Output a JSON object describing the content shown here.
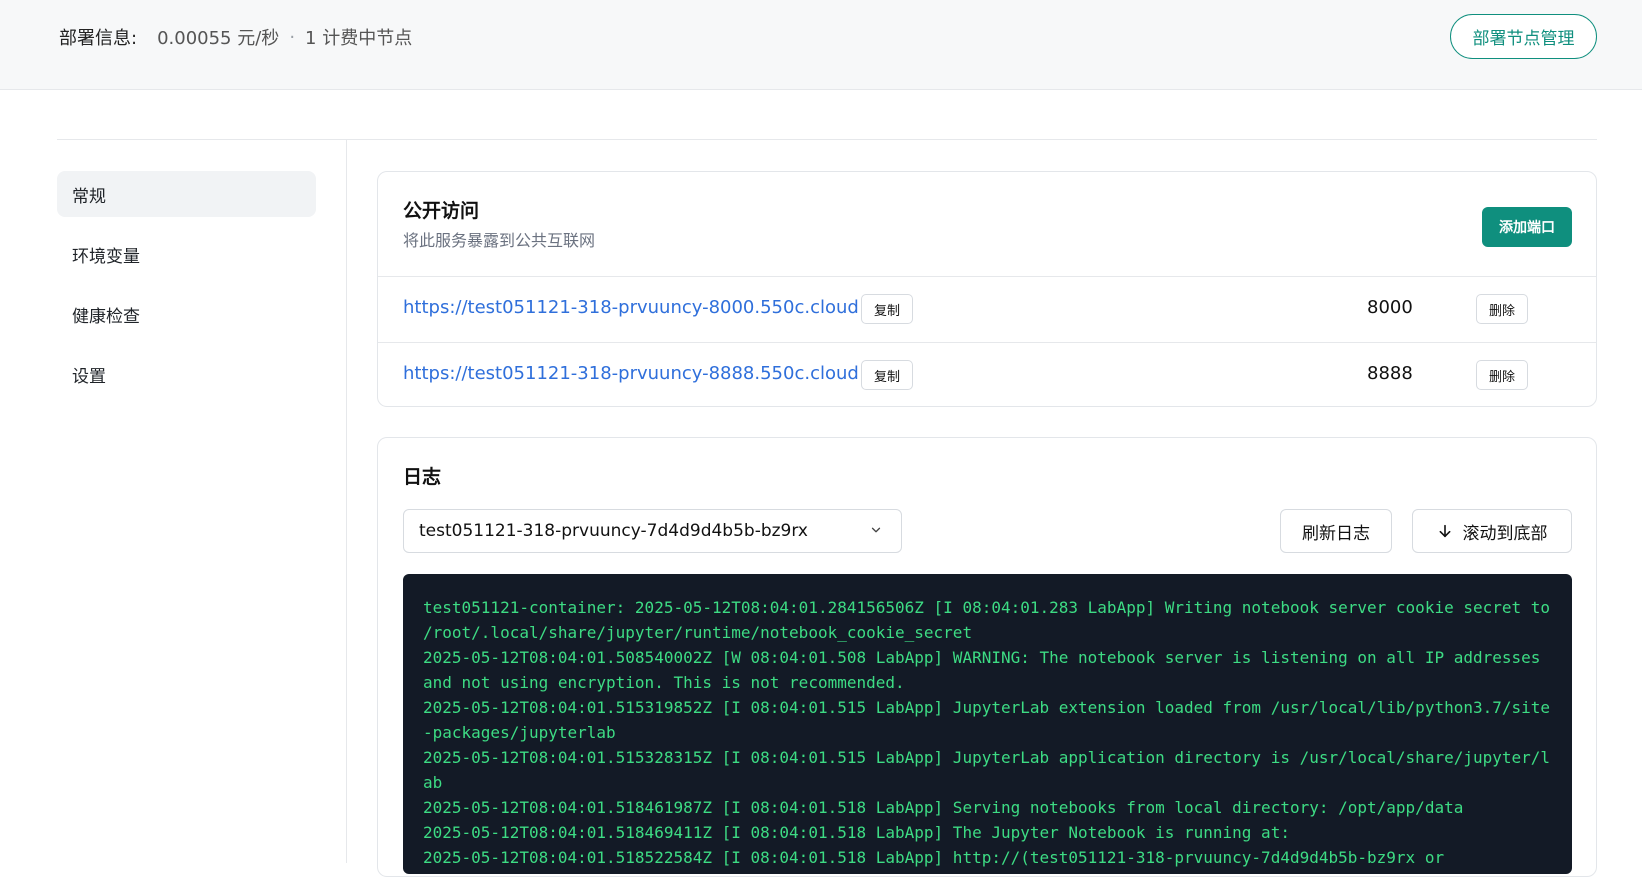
{
  "header": {
    "deploy_label": "部署信息:",
    "price": "0.00055 元/秒",
    "separator": "·",
    "nodes": "1 计费中节点",
    "node_mgmt_button": "部署节点管理"
  },
  "sidebar": {
    "items": [
      {
        "label": "常规",
        "active": true
      },
      {
        "label": "环境变量",
        "active": false
      },
      {
        "label": "健康检查",
        "active": false
      },
      {
        "label": "设置",
        "active": false
      }
    ]
  },
  "public_access": {
    "title": "公开访问",
    "subtitle": "将此服务暴露到公共互联网",
    "add_port_button": "添加端口",
    "ports": [
      {
        "url": "https://test051121-318-prvuuncy-8000.550c.cloud",
        "copy_label": "复制",
        "port": "8000",
        "delete_label": "删除"
      },
      {
        "url": "https://test051121-318-prvuuncy-8888.550c.cloud",
        "copy_label": "复制",
        "port": "8888",
        "delete_label": "删除"
      }
    ]
  },
  "logs": {
    "title": "日志",
    "pod_selected": "test051121-318-prvuuncy-7d4d9d4b5b-bz9rx",
    "refresh_button": "刷新日志",
    "scroll_button": "滚动到底部",
    "lines": [
      "test051121-container: 2025-05-12T08:04:01.284156506Z [I 08:04:01.283 LabApp] Writing notebook server cookie secret to /root/.local/share/jupyter/runtime/notebook_cookie_secret",
      "2025-05-12T08:04:01.508540002Z [W 08:04:01.508 LabApp] WARNING: The notebook server is listening on all IP addresses and not using encryption. This is not recommended.",
      "2025-05-12T08:04:01.515319852Z [I 08:04:01.515 LabApp] JupyterLab extension loaded from /usr/local/lib/python3.7/site-packages/jupyterlab",
      "2025-05-12T08:04:01.515328315Z [I 08:04:01.515 LabApp] JupyterLab application directory is /usr/local/share/jupyter/lab",
      "2025-05-12T08:04:01.518461987Z [I 08:04:01.518 LabApp] Serving notebooks from local directory: /opt/app/data",
      "2025-05-12T08:04:01.518469411Z [I 08:04:01.518 LabApp] The Jupyter Notebook is running at:",
      "2025-05-12T08:04:01.518522584Z [I 08:04:01.518 LabApp] http://(test051121-318-prvuuncy-7d4d9d4b5b-bz9rx or"
    ]
  },
  "colors": {
    "accent": "#0f8f7e",
    "link": "#2f6fdb",
    "console_bg": "#131a26",
    "console_text": "#3ddc84"
  }
}
